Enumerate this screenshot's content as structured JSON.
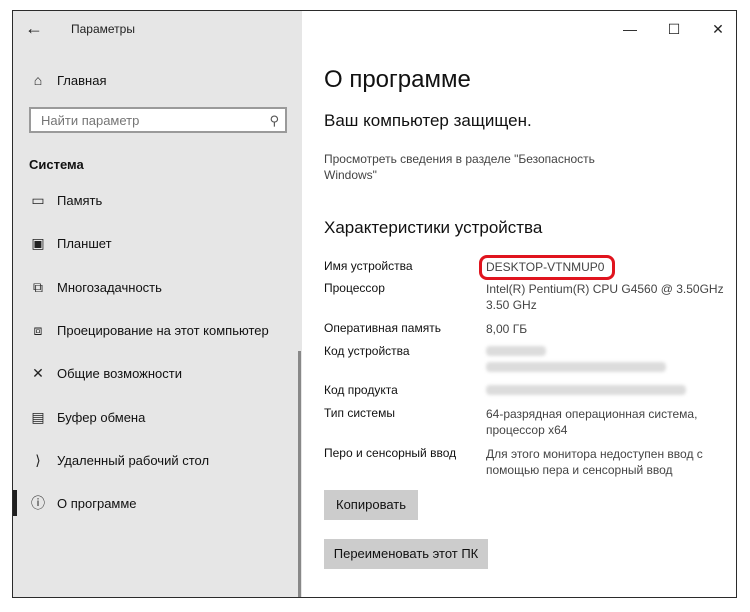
{
  "sidebar": {
    "app_title": "Параметры",
    "back_icon": "back-arrow-icon",
    "home_label": "Главная",
    "search_placeholder": "Найти параметр",
    "section_title": "Система",
    "items": [
      {
        "label": "Память",
        "icon": "storage-icon"
      },
      {
        "label": "Планшет",
        "icon": "tablet-icon"
      },
      {
        "label": "Многозадачность",
        "icon": "multitasking-icon"
      },
      {
        "label": "Проецирование на этот компьютер",
        "icon": "projecting-icon"
      },
      {
        "label": "Общие возможности",
        "icon": "shared-experiences-icon"
      },
      {
        "label": "Буфер обмена",
        "icon": "clipboard-icon"
      },
      {
        "label": "Удаленный рабочий стол",
        "icon": "remote-desktop-icon"
      },
      {
        "label": "О программе",
        "icon": "info-icon",
        "selected": true
      }
    ]
  },
  "window_controls": {
    "minimize": "—",
    "maximize": "☐",
    "close": "✕"
  },
  "main": {
    "page_title": "О программе",
    "protected_text": "Ваш компьютер защищен.",
    "security_link": "Просмотреть сведения в разделе \"Безопасность Windows\"",
    "specs_title": "Характеристики устройства",
    "specs": [
      {
        "label": "Имя устройства",
        "value": "DESKTOP-VTNMUP0"
      },
      {
        "label": "Процессор",
        "value": "Intel(R) Pentium(R) CPU G4560 @ 3.50GHz   3.50 GHz"
      },
      {
        "label": "Оперативная память",
        "value": "8,00 ГБ"
      },
      {
        "label": "Код устройства",
        "value": ""
      },
      {
        "label": "Код продукта",
        "value": ""
      },
      {
        "label": "Тип системы",
        "value": "64-разрядная операционная система, процессор x64"
      },
      {
        "label": "Перо и сенсорный ввод",
        "value": "Для этого монитора недоступен ввод с помощью пера и сенсорный ввод"
      }
    ],
    "copy_button": "Копировать",
    "rename_button": "Переименовать этот ПК"
  },
  "colors": {
    "highlight": "#e0141e",
    "sidebar_bg": "#e6e6e6",
    "button_bg": "#cccccc"
  }
}
